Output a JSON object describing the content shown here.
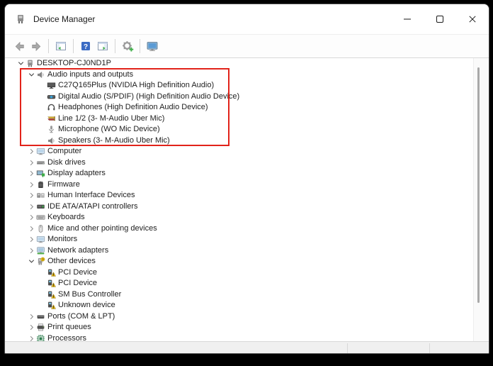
{
  "window": {
    "title": "Device Manager"
  },
  "titlebar_controls": [
    {
      "name": "minimize-button",
      "icon": "minimize-icon"
    },
    {
      "name": "maximize-button",
      "icon": "maximize-icon"
    },
    {
      "name": "close-button",
      "icon": "close-icon"
    }
  ],
  "toolbar": {
    "items": [
      {
        "type": "button",
        "name": "back-button",
        "icon": "back-arrow-icon"
      },
      {
        "type": "button",
        "name": "forward-button",
        "icon": "forward-arrow-icon"
      },
      {
        "type": "separator"
      },
      {
        "type": "button",
        "name": "show-console-tree-button",
        "icon": "console-tree-icon"
      },
      {
        "type": "separator"
      },
      {
        "type": "button",
        "name": "help-button",
        "icon": "help-icon"
      },
      {
        "type": "button",
        "name": "show-action-pane-button",
        "icon": "action-pane-icon"
      },
      {
        "type": "separator"
      },
      {
        "type": "button",
        "name": "scan-hardware-changes-button",
        "icon": "scan-hardware-icon"
      },
      {
        "type": "separator"
      },
      {
        "type": "button",
        "name": "computer-button",
        "icon": "computer-monitor-icon"
      }
    ]
  },
  "tree": {
    "rows": [
      {
        "label": "DESKTOP-CJ0ND1P",
        "level": 0,
        "state": "expanded",
        "icon": "computer-device-icon"
      },
      {
        "label": "Audio inputs and outputs",
        "level": 1,
        "state": "expanded",
        "icon": "speaker-icon"
      },
      {
        "label": "C27Q165Plus (NVIDIA High Definition Audio)",
        "level": 2,
        "state": "none",
        "icon": "monitor-dark-icon"
      },
      {
        "label": "Digital Audio (S/PDIF) (High Definition Audio Device)",
        "level": 2,
        "state": "none",
        "icon": "spdif-icon"
      },
      {
        "label": "Headphones (High Definition Audio Device)",
        "level": 2,
        "state": "none",
        "icon": "headphones-icon"
      },
      {
        "label": "Line 1/2 (3- M-Audio Uber Mic)",
        "level": 2,
        "state": "none",
        "icon": "line-jack-icon"
      },
      {
        "label": "Microphone (WO Mic Device)",
        "level": 2,
        "state": "none",
        "icon": "microphone-icon"
      },
      {
        "label": "Speakers (3- M-Audio Uber Mic)",
        "level": 2,
        "state": "none",
        "icon": "speaker-icon"
      },
      {
        "label": "Computer",
        "level": 1,
        "state": "collapsed",
        "icon": "monitor-icon"
      },
      {
        "label": "Disk drives",
        "level": 1,
        "state": "collapsed",
        "icon": "disk-drive-icon"
      },
      {
        "label": "Display adapters",
        "level": 1,
        "state": "collapsed",
        "icon": "display-adapter-icon"
      },
      {
        "label": "Firmware",
        "level": 1,
        "state": "collapsed",
        "icon": "firmware-icon"
      },
      {
        "label": "Human Interface Devices",
        "level": 1,
        "state": "collapsed",
        "icon": "hid-icon"
      },
      {
        "label": "IDE ATA/ATAPI controllers",
        "level": 1,
        "state": "collapsed",
        "icon": "ide-controller-icon"
      },
      {
        "label": "Keyboards",
        "level": 1,
        "state": "collapsed",
        "icon": "keyboard-icon"
      },
      {
        "label": "Mice and other pointing devices",
        "level": 1,
        "state": "collapsed",
        "icon": "mouse-icon"
      },
      {
        "label": "Monitors",
        "level": 1,
        "state": "collapsed",
        "icon": "monitor-icon"
      },
      {
        "label": "Network adapters",
        "level": 1,
        "state": "collapsed",
        "icon": "network-adapter-icon"
      },
      {
        "label": "Other devices",
        "level": 1,
        "state": "expanded",
        "icon": "other-device-icon"
      },
      {
        "label": "PCI Device",
        "level": 2,
        "state": "none",
        "icon": "warning-device-icon"
      },
      {
        "label": "PCI Device",
        "level": 2,
        "state": "none",
        "icon": "warning-device-icon"
      },
      {
        "label": "SM Bus Controller",
        "level": 2,
        "state": "none",
        "icon": "warning-device-icon"
      },
      {
        "label": "Unknown device",
        "level": 2,
        "state": "none",
        "icon": "warning-device-icon"
      },
      {
        "label": "Ports (COM & LPT)",
        "level": 1,
        "state": "collapsed",
        "icon": "ports-icon"
      },
      {
        "label": "Print queues",
        "level": 1,
        "state": "collapsed",
        "icon": "printer-icon"
      },
      {
        "label": "Processors",
        "level": 1,
        "state": "collapsed",
        "icon": "processor-icon"
      }
    ]
  },
  "annotation": {
    "shape": "rectangle",
    "color": "#e2231a"
  },
  "statusbar": {
    "text": ""
  }
}
